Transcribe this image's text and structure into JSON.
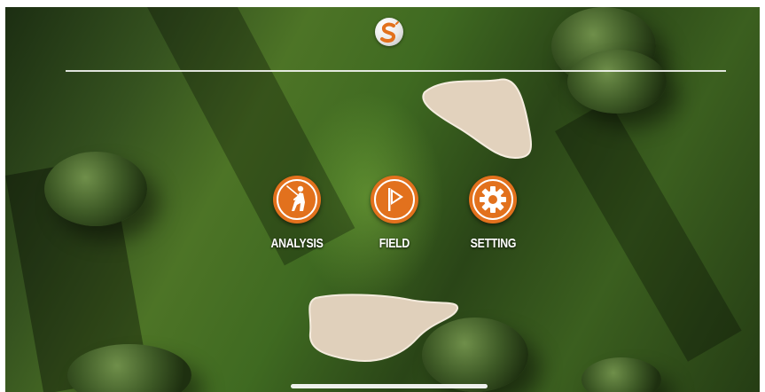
{
  "app": {
    "logo_icon": "s-logo-icon"
  },
  "menu": {
    "items": [
      {
        "id": "analysis",
        "label": "ANALYSIS",
        "icon": "golfer-icon"
      },
      {
        "id": "field",
        "label": "FIELD",
        "icon": "flag-icon"
      },
      {
        "id": "setting",
        "label": "SETTING",
        "icon": "gear-icon"
      }
    ]
  },
  "colors": {
    "accent": "#e2711d",
    "icon_foreground": "#ffffff",
    "label": "#ffffff"
  }
}
